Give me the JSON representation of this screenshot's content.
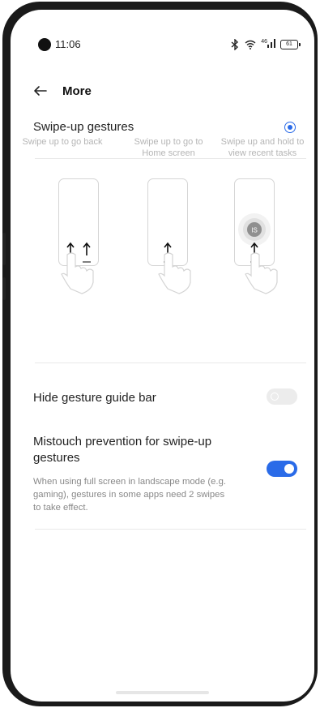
{
  "status_bar": {
    "time": "11:06",
    "signal": "46",
    "battery": "61"
  },
  "header": {
    "title": "More"
  },
  "swipe_up": {
    "label": "Swipe-up gestures",
    "selected": true
  },
  "gestures": [
    {
      "caption_lines": [
        "Swipe up to go back"
      ]
    },
    {
      "caption_lines": [
        "Swipe up to go to",
        "Home screen"
      ]
    },
    {
      "caption_lines": [
        "Swipe up and hold to",
        "view recent tasks"
      ],
      "badge": "IS"
    }
  ],
  "hide_bar": {
    "label": "Hide gesture guide bar",
    "enabled": false
  },
  "mistouch": {
    "label_lines": [
      "Mistouch prevention for swipe-up",
      "gestures"
    ],
    "description_lines": [
      "When using full screen in landscape mode (e.g.",
      "gaming), gestures in some apps need 2 swipes",
      "to take effect."
    ],
    "enabled": true
  },
  "colors": {
    "accent": "#2a6be8",
    "caption": "#b5b5b5",
    "description": "#888888"
  }
}
